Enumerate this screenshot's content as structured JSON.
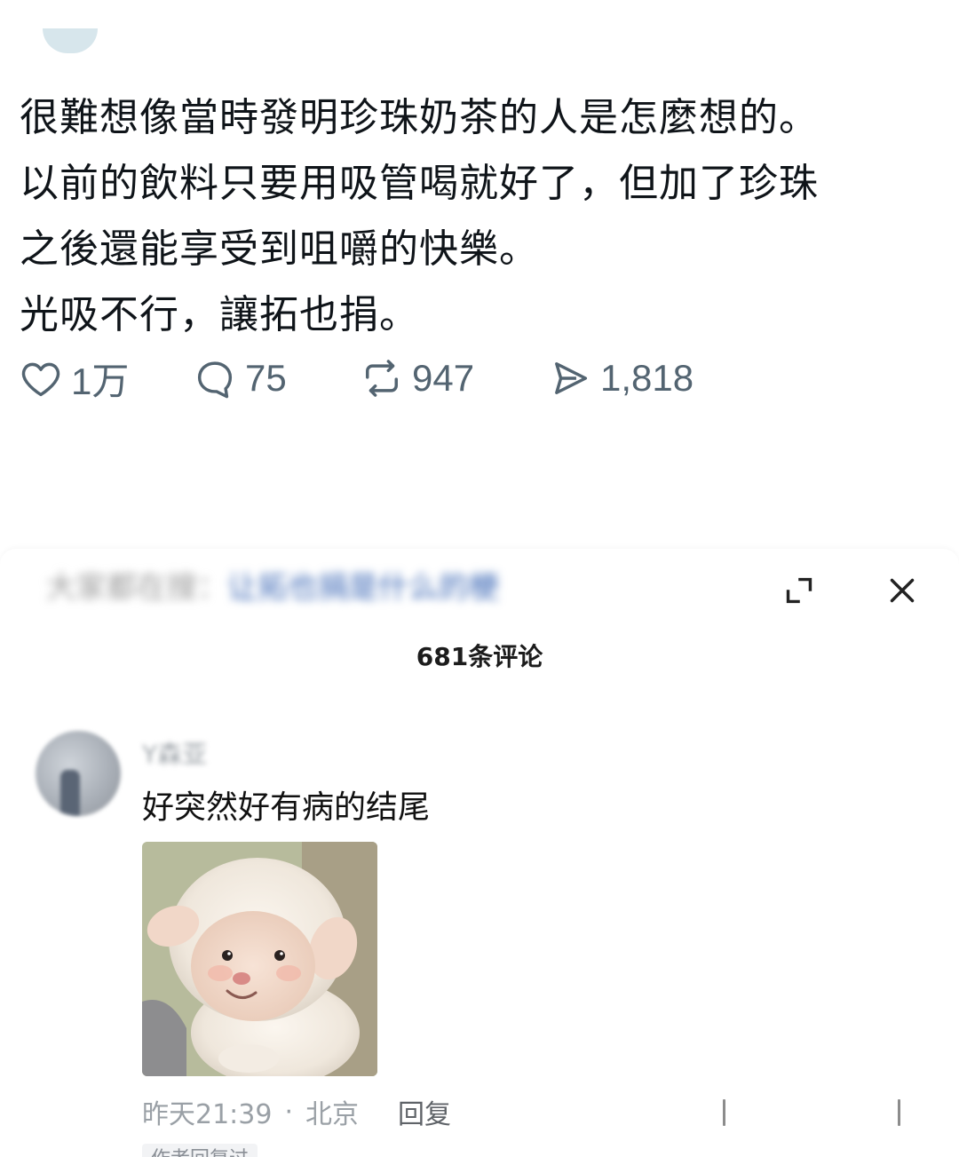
{
  "tweet": {
    "lines": [
      "很難想像當時發明珍珠奶茶的人是怎麼想的。",
      "以前的飲料只要用吸管喝就好了，但加了珍珠",
      "之後還能享受到咀嚼的快樂。",
      "光吸不行，讓拓也捐。"
    ],
    "actions": {
      "like": {
        "icon": "heart-icon",
        "count": "1万"
      },
      "reply": {
        "icon": "comment-bubble-icon",
        "count": "75"
      },
      "retweet": {
        "icon": "retweet-icon",
        "count": "947"
      },
      "views": {
        "icon": "views-icon",
        "count": "1,818"
      }
    }
  },
  "comments_sheet": {
    "header_title_blurred_gray": "大家都在搜：",
    "header_title_blurred_blue": "让拓也捐是什么的梗",
    "expand_icon": "expand-icon",
    "close_icon": "close-icon",
    "comment_count": "681条评论",
    "comment": {
      "username_blurred": "Y森亚",
      "text": "好突然好有病的结尾",
      "image_alt": "lamb-photo",
      "time": "昨天21:39",
      "separator": "·",
      "location": "北京",
      "reply_label": "回复",
      "author_replied_badge": "作者回复过"
    }
  },
  "colors": {
    "text_primary": "#0f1419",
    "text_secondary": "#536471",
    "meta_gray": "#9aa0a6",
    "link_blue": "#3b67b5"
  }
}
